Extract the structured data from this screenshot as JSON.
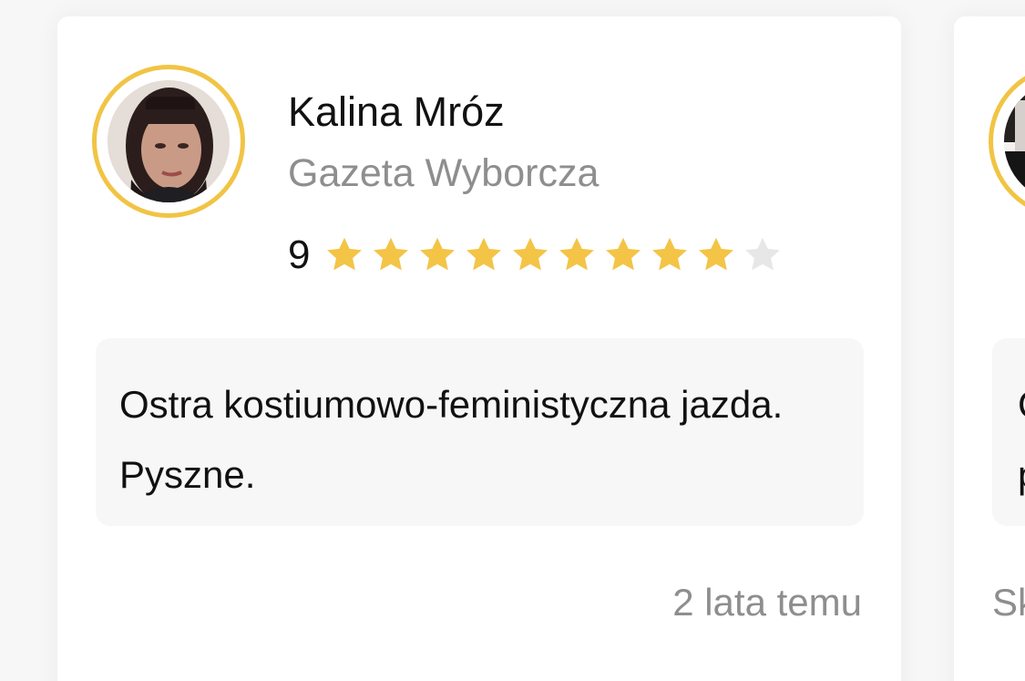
{
  "reviews": [
    {
      "name": "Kalina Mróz",
      "publication": "Gazeta Wyborcza",
      "rating": 9,
      "rating_max": 10,
      "text": "Ostra kostiumowo-feministyczna jazda. Pyszne.",
      "time_ago": "2 lata temu"
    },
    {
      "name": "",
      "publication": "",
      "text_partial": "C\np",
      "time_ago_partial": "Sk"
    }
  ],
  "colors": {
    "accent": "#f1c444",
    "star_filled": "#f3c446",
    "star_empty": "#e7e7e7",
    "muted_text": "#8e8e8e"
  },
  "icons": {
    "star": "star-icon"
  }
}
